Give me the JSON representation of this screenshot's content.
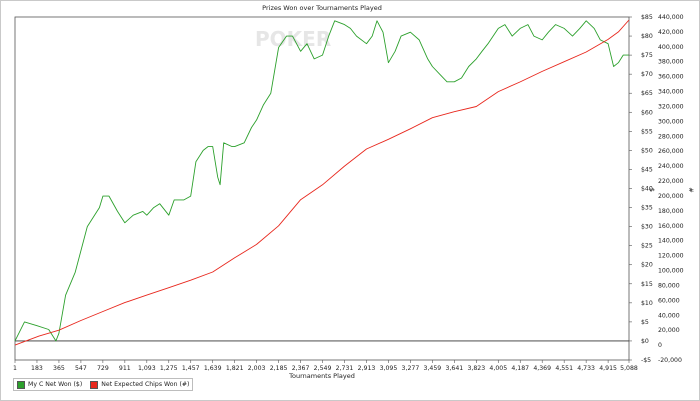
{
  "chart_data": {
    "type": "line",
    "title": "Prizes Won over Tournaments Played",
    "xlabel": "Tournaments Played",
    "ylabel_left": "$",
    "ylabel_right": "#",
    "watermark": "POKER",
    "x_range": [
      1,
      5088
    ],
    "x_ticks": [
      "1",
      "183",
      "365",
      "547",
      "729",
      "911",
      "1,093",
      "1,275",
      "1,457",
      "1,639",
      "1,821",
      "2,003",
      "2,185",
      "2,367",
      "2,549",
      "2,731",
      "2,913",
      "3,095",
      "3,277",
      "3,459",
      "3,641",
      "3,823",
      "4,005",
      "4,187",
      "4,369",
      "4,551",
      "4,733",
      "4,915",
      "5,088"
    ],
    "y_left": {
      "range": [
        -5,
        85
      ],
      "ticks": [
        "-$5",
        "$0",
        "$5",
        "$10",
        "$15",
        "$20",
        "$25",
        "$30",
        "$35",
        "$40",
        "$45",
        "$50",
        "$55",
        "$60",
        "$65",
        "$70",
        "$75",
        "$80",
        "$85"
      ]
    },
    "y_right": {
      "range": [
        -20000,
        440000
      ],
      "ticks": [
        "-20,000",
        "0",
        "20,000",
        "40,000",
        "60,000",
        "80,000",
        "100,000",
        "120,000",
        "140,000",
        "160,000",
        "180,000",
        "200,000",
        "220,000",
        "240,000",
        "260,000",
        "280,000",
        "300,000",
        "320,000",
        "340,000",
        "360,000",
        "380,000",
        "400,000",
        "420,000",
        "440,000"
      ]
    },
    "grid": false,
    "legend_position": "bottom-left",
    "series": [
      {
        "name": "My C Net Won ($)",
        "axis": "left",
        "color": "#2ca02c",
        "points": [
          [
            1,
            0
          ],
          [
            80,
            5
          ],
          [
            183,
            4
          ],
          [
            280,
            3
          ],
          [
            340,
            0
          ],
          [
            365,
            2
          ],
          [
            420,
            12
          ],
          [
            500,
            18
          ],
          [
            600,
            30
          ],
          [
            700,
            35
          ],
          [
            729,
            38
          ],
          [
            780,
            38
          ],
          [
            850,
            34
          ],
          [
            911,
            31
          ],
          [
            980,
            33
          ],
          [
            1060,
            34
          ],
          [
            1093,
            33
          ],
          [
            1150,
            35
          ],
          [
            1200,
            36
          ],
          [
            1275,
            33
          ],
          [
            1320,
            37
          ],
          [
            1400,
            37
          ],
          [
            1457,
            38
          ],
          [
            1500,
            47
          ],
          [
            1560,
            50
          ],
          [
            1600,
            51
          ],
          [
            1639,
            51
          ],
          [
            1680,
            43
          ],
          [
            1700,
            41
          ],
          [
            1730,
            52
          ],
          [
            1800,
            51
          ],
          [
            1821,
            51
          ],
          [
            1900,
            52
          ],
          [
            1960,
            56
          ],
          [
            2003,
            58
          ],
          [
            2060,
            62
          ],
          [
            2120,
            65
          ],
          [
            2185,
            77
          ],
          [
            2250,
            80
          ],
          [
            2300,
            80
          ],
          [
            2367,
            76
          ],
          [
            2420,
            78
          ],
          [
            2480,
            74
          ],
          [
            2549,
            75
          ],
          [
            2600,
            80
          ],
          [
            2650,
            84
          ],
          [
            2731,
            83
          ],
          [
            2780,
            82
          ],
          [
            2830,
            80
          ],
          [
            2913,
            78
          ],
          [
            2960,
            80
          ],
          [
            3000,
            84
          ],
          [
            3050,
            81
          ],
          [
            3095,
            73
          ],
          [
            3150,
            76
          ],
          [
            3200,
            80
          ],
          [
            3277,
            81
          ],
          [
            3350,
            79
          ],
          [
            3420,
            74
          ],
          [
            3459,
            72
          ],
          [
            3520,
            70
          ],
          [
            3580,
            68
          ],
          [
            3641,
            68
          ],
          [
            3700,
            69
          ],
          [
            3760,
            72
          ],
          [
            3823,
            74
          ],
          [
            3870,
            76
          ],
          [
            3920,
            78
          ],
          [
            4005,
            82
          ],
          [
            4060,
            83
          ],
          [
            4120,
            80
          ],
          [
            4187,
            82
          ],
          [
            4250,
            83
          ],
          [
            4300,
            80
          ],
          [
            4369,
            79
          ],
          [
            4420,
            81
          ],
          [
            4480,
            83
          ],
          [
            4551,
            82
          ],
          [
            4620,
            80
          ],
          [
            4680,
            82
          ],
          [
            4733,
            84
          ],
          [
            4800,
            82
          ],
          [
            4850,
            79
          ],
          [
            4915,
            78
          ],
          [
            4960,
            72
          ],
          [
            5000,
            73
          ],
          [
            5040,
            75
          ],
          [
            5088,
            75
          ]
        ]
      },
      {
        "name": "Net Expected Chips Won (#)",
        "axis": "right",
        "color": "#e8281e",
        "points": [
          [
            1,
            0
          ],
          [
            200,
            12000
          ],
          [
            365,
            20000
          ],
          [
            547,
            33000
          ],
          [
            729,
            45000
          ],
          [
            911,
            57000
          ],
          [
            1093,
            67000
          ],
          [
            1275,
            77000
          ],
          [
            1457,
            87000
          ],
          [
            1639,
            98000
          ],
          [
            1821,
            117000
          ],
          [
            2003,
            135000
          ],
          [
            2185,
            160000
          ],
          [
            2367,
            195000
          ],
          [
            2549,
            215000
          ],
          [
            2731,
            240000
          ],
          [
            2913,
            263000
          ],
          [
            3095,
            276000
          ],
          [
            3277,
            290000
          ],
          [
            3459,
            305000
          ],
          [
            3641,
            313000
          ],
          [
            3823,
            320000
          ],
          [
            4005,
            340000
          ],
          [
            4187,
            353000
          ],
          [
            4369,
            367000
          ],
          [
            4551,
            380000
          ],
          [
            4733,
            393000
          ],
          [
            4915,
            410000
          ],
          [
            5000,
            420000
          ],
          [
            5088,
            436000
          ]
        ]
      }
    ]
  }
}
